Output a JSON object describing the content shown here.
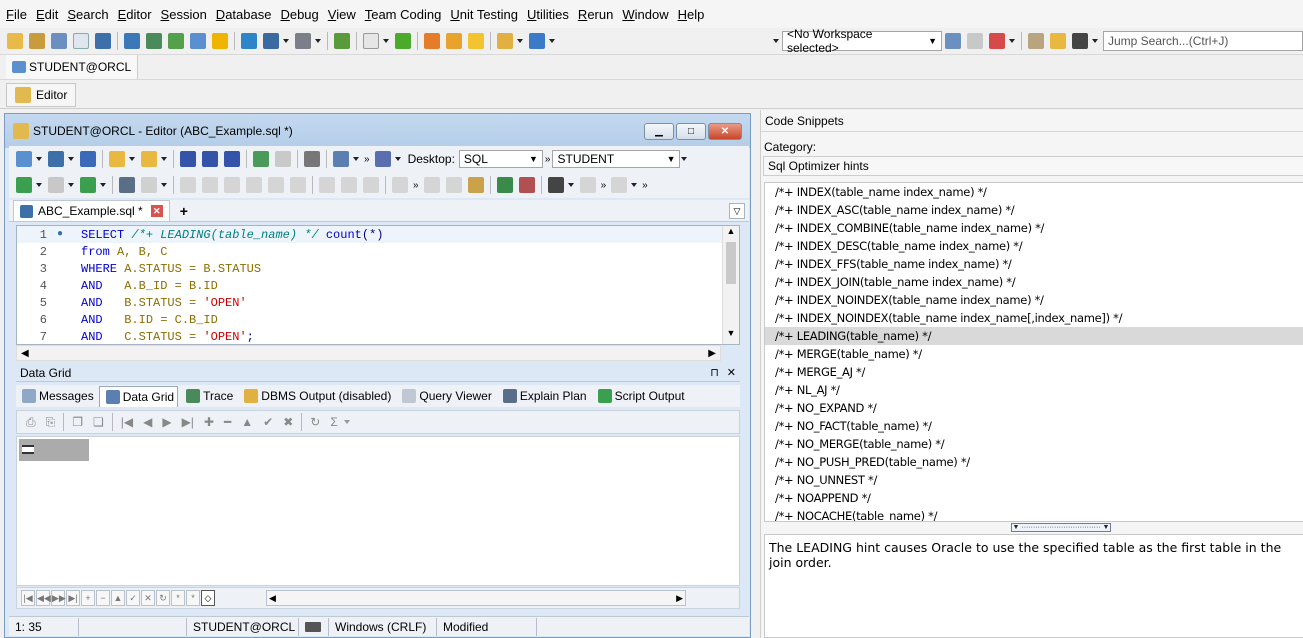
{
  "menu": [
    "File",
    "Edit",
    "Search",
    "Editor",
    "Session",
    "Database",
    "Debug",
    "View",
    "Team Coding",
    "Unit Testing",
    "Utilities",
    "Rerun",
    "Window",
    "Help"
  ],
  "toolbar": {
    "workspace": "<No Workspace selected>",
    "jump_placeholder": "Jump Search...(Ctrl+J)"
  },
  "connection_tab": "STUDENT@ORCL",
  "editor_button": "Editor",
  "editor": {
    "title": "STUDENT@ORCL - Editor (ABC_Example.sql *)",
    "desktop_label": "Desktop:",
    "desktop_value": "SQL",
    "schema_value": "STUDENT",
    "doc_tab": "ABC_Example.sql *",
    "doc_tab_add": "+",
    "lines": [
      {
        "n": "1",
        "parts": [
          [
            "kw",
            "SELECT "
          ],
          [
            "cmt",
            "/*+ LEADING(table_name) */ "
          ],
          [
            "kw",
            "count"
          ],
          [
            "txt",
            "(*)"
          ]
        ]
      },
      {
        "n": "2",
        "parts": [
          [
            "kw",
            "from "
          ],
          [
            "id",
            "A, B, C"
          ]
        ]
      },
      {
        "n": "3",
        "parts": [
          [
            "kw",
            "WHERE "
          ],
          [
            "id",
            "A.STATUS = B.STATUS"
          ]
        ]
      },
      {
        "n": "4",
        "parts": [
          [
            "kw",
            "AND   "
          ],
          [
            "id",
            "A.B_ID = B.ID"
          ]
        ]
      },
      {
        "n": "5",
        "parts": [
          [
            "kw",
            "AND   "
          ],
          [
            "id",
            "B.STATUS = "
          ],
          [
            "str",
            "'OPEN'"
          ]
        ]
      },
      {
        "n": "6",
        "parts": [
          [
            "kw",
            "AND   "
          ],
          [
            "id",
            "B.ID = C.B_ID"
          ]
        ]
      },
      {
        "n": "7",
        "parts": [
          [
            "kw",
            "AND   "
          ],
          [
            "id",
            "C.STATUS = "
          ],
          [
            "str",
            "'OPEN'"
          ],
          [
            "txt",
            ";"
          ]
        ]
      }
    ]
  },
  "datagrid": {
    "title": "Data Grid",
    "pin": "⊓",
    "close": "✕",
    "tabs": [
      "Messages",
      "Data Grid",
      "Trace",
      "DBMS Output (disabled)",
      "Query Viewer",
      "Explain Plan",
      "Script Output"
    ]
  },
  "status": {
    "position": "1:  35",
    "connection": "STUDENT@ORCL",
    "line_endings": "Windows (CRLF)",
    "state": "Modified"
  },
  "snippets": {
    "title": "Code Snippets",
    "category_label": "Category:",
    "category": "Sql Optimizer hints",
    "selected_index": 8,
    "hints": [
      "/*+ INDEX(table_name index_name) */",
      "/*+ INDEX_ASC(table_name index_name) */",
      "/*+ INDEX_COMBINE(table_name index_name) */",
      "/*+ INDEX_DESC(table_name index_name) */",
      "/*+ INDEX_FFS(table_name index_name) */",
      "/*+ INDEX_JOIN(table_name index_name) */",
      "/*+ INDEX_NOINDEX(table_name index_name) */",
      "/*+ INDEX_NOINDEX(table_name index_name[,index_name]) */",
      "/*+ LEADING(table_name) */",
      "/*+ MERGE(table_name) */",
      "/*+ MERGE_AJ */",
      "/*+ NL_AJ */",
      "/*+ NO_EXPAND */",
      "/*+ NO_FACT(table_name) */",
      "/*+ NO_MERGE(table_name) */",
      "/*+ NO_PUSH_PRED(table_name) */",
      "/*+ NO_UNNEST */",
      "/*+ NOAPPEND */",
      "/*+ NOCACHE(table_name) */"
    ],
    "description": "The LEADING hint causes Oracle to use the specified table as the first table in the join order."
  }
}
